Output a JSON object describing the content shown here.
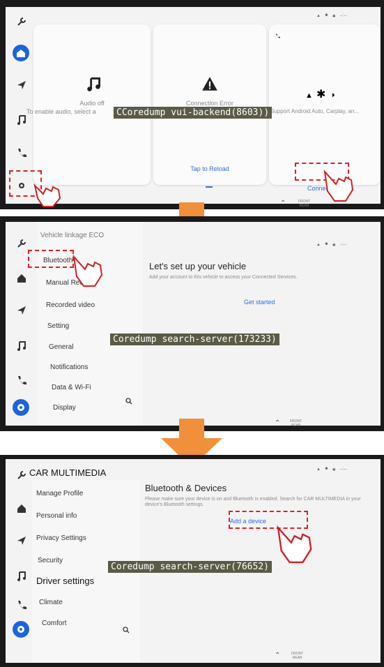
{
  "panel1": {
    "cards": {
      "audio": {
        "title": "Audio off",
        "subtitle": "To enable audio, select a"
      },
      "connection": {
        "title": "Connection Error",
        "action": "Tap to Reload"
      },
      "phone": {
        "subtitle": "Support Android Auto, Carplay, an...",
        "action": "Connect"
      }
    },
    "overlay": "CCoredump vui-backend(8603))"
  },
  "panel2": {
    "menu": [
      "Vehicle linkage ECO",
      "Bluetooth",
      "Manual Reco",
      "Recorded video",
      "Setting",
      "General",
      "Notifications",
      "Data & Wi-Fi",
      "Display"
    ],
    "title": "Let's set up your vehicle",
    "subtitle": "Add your account to this vehicle to access your Connected Services.",
    "action": "Get started",
    "overlay": "Coredump search-server(173233)"
  },
  "panel3": {
    "app_title": "CAR MULTIMEDIA",
    "menu": [
      "Manage Profile",
      "Personal info",
      "Privacy Settings",
      "Security",
      "Driver settings",
      "Climate",
      "Comfort"
    ],
    "title": "Bluetooth & Devices",
    "subtitle": "Please make sure your device is on and Bluetooth is enabled. Search for CAR MULTIMEDIA in your device's Bluetooth settings.",
    "action": "Add a device",
    "overlay": "Coredump search-server(76652)"
  },
  "common": {
    "front_label_1": "FRONT",
    "front_label_2": "REAR"
  },
  "colors": {
    "accent": "#1e64d6",
    "link": "#2f6fd6",
    "arrow": "#f0903a",
    "highlight": "#e02020"
  }
}
